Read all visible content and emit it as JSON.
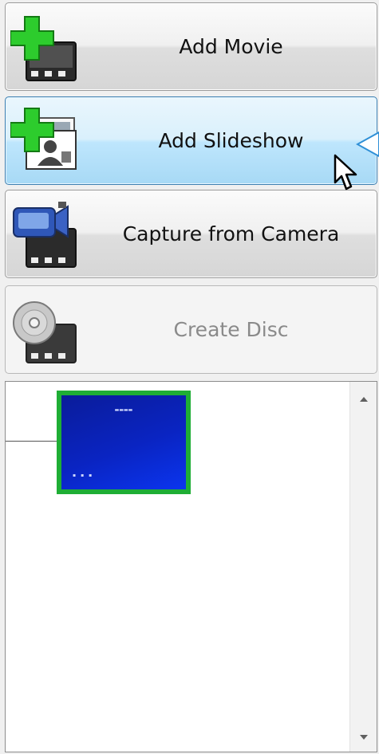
{
  "buttons": {
    "add_movie": "Add Movie",
    "add_slideshow": "Add Slideshow",
    "capture_camera": "Capture from Camera",
    "create_disc": "Create Disc"
  },
  "icons": {
    "add_movie": "add-movie-icon",
    "add_slideshow": "add-slideshow-icon",
    "capture_camera": "camera-film-icon",
    "create_disc": "disc-film-icon"
  },
  "colors": {
    "accent_green": "#1fae35",
    "hover_blue": "#bee6fd",
    "thumbnail_blue": "#0a24c2"
  },
  "state": {
    "hovered_button": "add_slideshow",
    "disabled_button": "create_disc"
  },
  "list": {
    "selected_item": 0
  }
}
